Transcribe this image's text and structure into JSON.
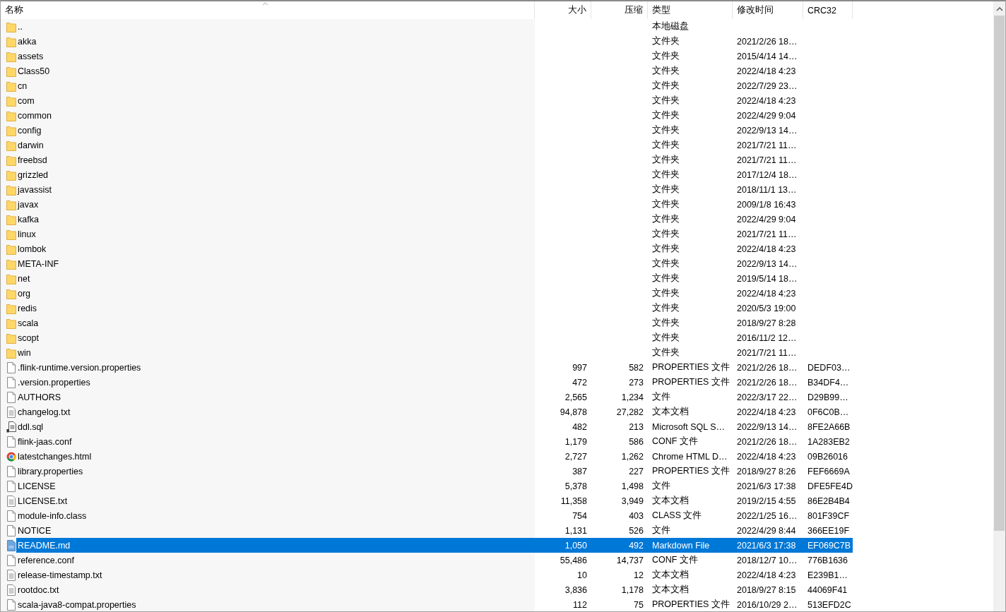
{
  "table": {
    "columns": [
      {
        "label": "名称",
        "sorted": true
      },
      {
        "label": "大小",
        "sorted": false
      },
      {
        "label": "压缩",
        "sorted": false
      },
      {
        "label": "类型",
        "sorted": false
      },
      {
        "label": "修改时间",
        "sorted": false
      },
      {
        "label": "CRC32",
        "sorted": false
      }
    ],
    "rows": [
      {
        "kind": "folder",
        "name": "..",
        "type": "本地磁盘",
        "selected": false
      },
      {
        "kind": "folder",
        "name": "akka",
        "type": "文件夹",
        "modified": "2021/2/26 18…",
        "selected": false
      },
      {
        "kind": "folder",
        "name": "assets",
        "type": "文件夹",
        "modified": "2015/4/14 14…",
        "selected": false
      },
      {
        "kind": "folder",
        "name": "Class50",
        "type": "文件夹",
        "modified": "2022/4/18 4:23",
        "selected": false
      },
      {
        "kind": "folder",
        "name": "cn",
        "type": "文件夹",
        "modified": "2022/7/29 23…",
        "selected": false
      },
      {
        "kind": "folder",
        "name": "com",
        "type": "文件夹",
        "modified": "2022/4/18 4:23",
        "selected": false
      },
      {
        "kind": "folder",
        "name": "common",
        "type": "文件夹",
        "modified": "2022/4/29 9:04",
        "selected": false
      },
      {
        "kind": "folder",
        "name": "config",
        "type": "文件夹",
        "modified": "2022/9/13 14…",
        "selected": false
      },
      {
        "kind": "folder",
        "name": "darwin",
        "type": "文件夹",
        "modified": "2021/7/21 11…",
        "selected": false
      },
      {
        "kind": "folder",
        "name": "freebsd",
        "type": "文件夹",
        "modified": "2021/7/21 11…",
        "selected": false
      },
      {
        "kind": "folder",
        "name": "grizzled",
        "type": "文件夹",
        "modified": "2017/12/4 18…",
        "selected": false
      },
      {
        "kind": "folder",
        "name": "javassist",
        "type": "文件夹",
        "modified": "2018/11/1 13…",
        "selected": false
      },
      {
        "kind": "folder",
        "name": "javax",
        "type": "文件夹",
        "modified": "2009/1/8 16:43",
        "selected": false
      },
      {
        "kind": "folder",
        "name": "kafka",
        "type": "文件夹",
        "modified": "2022/4/29 9:04",
        "selected": false
      },
      {
        "kind": "folder",
        "name": "linux",
        "type": "文件夹",
        "modified": "2021/7/21 11…",
        "selected": false
      },
      {
        "kind": "folder",
        "name": "lombok",
        "type": "文件夹",
        "modified": "2022/4/18 4:23",
        "selected": false
      },
      {
        "kind": "folder",
        "name": "META-INF",
        "type": "文件夹",
        "modified": "2022/9/13 14…",
        "selected": false
      },
      {
        "kind": "folder",
        "name": "net",
        "type": "文件夹",
        "modified": "2019/5/14 18…",
        "selected": false
      },
      {
        "kind": "folder",
        "name": "org",
        "type": "文件夹",
        "modified": "2022/4/18 4:23",
        "selected": false
      },
      {
        "kind": "folder",
        "name": "redis",
        "type": "文件夹",
        "modified": "2020/5/3 19:00",
        "selected": false
      },
      {
        "kind": "folder",
        "name": "scala",
        "type": "文件夹",
        "modified": "2018/9/27 8:28",
        "selected": false
      },
      {
        "kind": "folder",
        "name": "scopt",
        "type": "文件夹",
        "modified": "2016/11/2 12…",
        "selected": false
      },
      {
        "kind": "folder",
        "name": "win",
        "type": "文件夹",
        "modified": "2021/7/21 11…",
        "selected": false
      },
      {
        "kind": "file",
        "name": ".flink-runtime.version.properties",
        "size": "997",
        "packed": "582",
        "type": "PROPERTIES 文件",
        "modified": "2021/2/26 18…",
        "crc": "DEDF03…",
        "selected": false
      },
      {
        "kind": "file",
        "name": ".version.properties",
        "size": "472",
        "packed": "273",
        "type": "PROPERTIES 文件",
        "modified": "2021/2/26 18…",
        "crc": "B34DF4…",
        "selected": false
      },
      {
        "kind": "file",
        "name": "AUTHORS",
        "size": "2,565",
        "packed": "1,234",
        "type": "文件",
        "modified": "2022/3/17 22…",
        "crc": "D29B99…",
        "selected": false
      },
      {
        "kind": "text",
        "name": "changelog.txt",
        "size": "94,878",
        "packed": "27,282",
        "type": "文本文档",
        "modified": "2022/4/18 4:23",
        "crc": "0F6C0B…",
        "selected": false
      },
      {
        "kind": "sql",
        "name": "ddl.sql",
        "size": "482",
        "packed": "213",
        "type": "Microsoft SQL S…",
        "modified": "2022/9/13 14…",
        "crc": "8FE2A66B",
        "selected": false
      },
      {
        "kind": "file",
        "name": "flink-jaas.conf",
        "size": "1,179",
        "packed": "586",
        "type": "CONF 文件",
        "modified": "2021/2/26 18…",
        "crc": "1A283EB2",
        "selected": false
      },
      {
        "kind": "web",
        "name": "latestchanges.html",
        "size": "2,727",
        "packed": "1,262",
        "type": "Chrome HTML D…",
        "modified": "2022/4/18 4:23",
        "crc": "09B26016",
        "selected": false
      },
      {
        "kind": "file",
        "name": "library.properties",
        "size": "387",
        "packed": "227",
        "type": "PROPERTIES 文件",
        "modified": "2018/9/27 8:26",
        "crc": "FEF6669A",
        "selected": false
      },
      {
        "kind": "file",
        "name": "LICENSE",
        "size": "5,378",
        "packed": "1,498",
        "type": "文件",
        "modified": "2021/6/3 17:38",
        "crc": "DFE5FE4D",
        "selected": false
      },
      {
        "kind": "text",
        "name": "LICENSE.txt",
        "size": "11,358",
        "packed": "3,949",
        "type": "文本文档",
        "modified": "2019/2/15 4:55",
        "crc": "86E2B4B4",
        "selected": false
      },
      {
        "kind": "file",
        "name": "module-info.class",
        "size": "754",
        "packed": "403",
        "type": "CLASS 文件",
        "modified": "2022/1/25 16…",
        "crc": "801F39CF",
        "selected": false
      },
      {
        "kind": "file",
        "name": "NOTICE",
        "size": "1,131",
        "packed": "526",
        "type": "文件",
        "modified": "2022/4/29 8:44",
        "crc": "366EE19F",
        "selected": false
      },
      {
        "kind": "markdown",
        "name": "README.md",
        "size": "1,050",
        "packed": "492",
        "type": "Markdown File",
        "modified": "2021/6/3 17:38",
        "crc": "EF069C7B",
        "selected": true
      },
      {
        "kind": "file",
        "name": "reference.conf",
        "size": "55,486",
        "packed": "14,737",
        "type": "CONF 文件",
        "modified": "2018/12/7 10…",
        "crc": "776B1636",
        "selected": false
      },
      {
        "kind": "text",
        "name": "release-timestamp.txt",
        "size": "10",
        "packed": "12",
        "type": "文本文档",
        "modified": "2022/4/18 4:23",
        "crc": "E239B1…",
        "selected": false
      },
      {
        "kind": "text",
        "name": "rootdoc.txt",
        "size": "3,836",
        "packed": "1,178",
        "type": "文本文档",
        "modified": "2018/9/27 8:15",
        "crc": "44069F41",
        "selected": false
      },
      {
        "kind": "file",
        "name": "scala-java8-compat.properties",
        "size": "112",
        "packed": "75",
        "type": "PROPERTIES 文件",
        "modified": "2016/10/29 2…",
        "crc": "513EFD2C",
        "selected": false
      }
    ]
  }
}
